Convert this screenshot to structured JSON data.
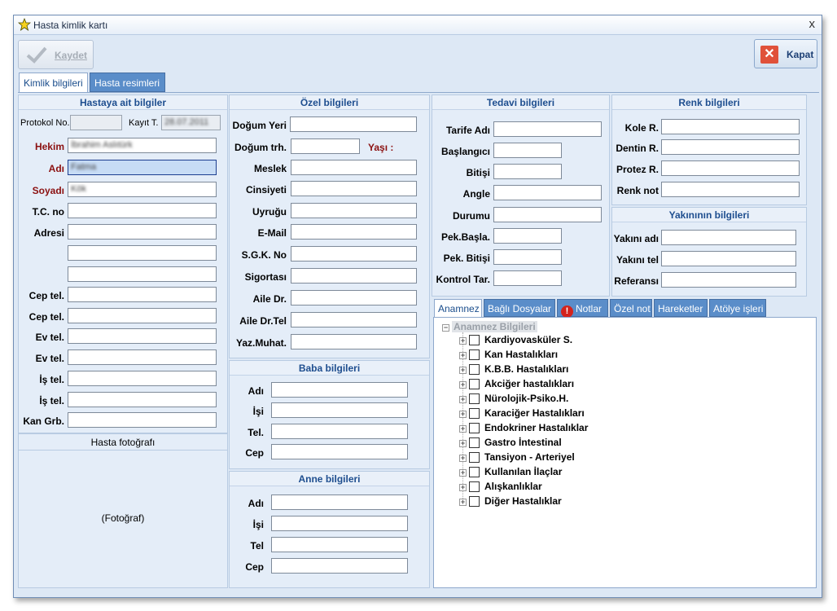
{
  "window": {
    "title": "Hasta kimlik kartı",
    "close_glyph": "x"
  },
  "toolbar": {
    "save_label": "Kaydet",
    "close_label": "Kapat"
  },
  "tabs": [
    "Kimlik bilgileri",
    "Hasta resimleri"
  ],
  "patient": {
    "header": "Hastaya ait bilgiler",
    "protocol_label": "Protokol No.",
    "protocol_value": "",
    "record_date_label": "Kayıt T.",
    "record_date_value": "28.07.2011",
    "doctor_label": "Hekim",
    "doctor_value": "İbrahim Aslıtürk",
    "name_label": "Adı",
    "name_value": "Fatma",
    "surname_label": "Soyadı",
    "surname_value": "Kök",
    "tc_label": "T.C. no",
    "address_label": "Adresi",
    "cep1_label": "Cep tel.",
    "cep2_label": "Cep tel.",
    "ev1_label": "Ev tel.",
    "ev2_label": "Ev tel.",
    "is1_label": "İş tel.",
    "is2_label": "İş tel.",
    "blood_label": "Kan Grb."
  },
  "photo": {
    "header": "Hasta fotoğrafı",
    "placeholder": "(Fotoğraf)"
  },
  "special": {
    "header": "Özel bilgileri",
    "birthplace_label": "Doğum Yeri",
    "birthdate_label": "Doğum trh.",
    "age_label": "Yaşı :",
    "job_label": "Meslek",
    "gender_label": "Cinsiyeti",
    "nationality_label": "Uyruğu",
    "email_label": "E-Mail",
    "sgk_label": "S.G.K. No",
    "insurance_label": "Sigortası",
    "family_dr_label": "Aile Dr.",
    "family_dr_tel_label": "Aile Dr.Tel",
    "correspondence_label": "Yaz.Muhat."
  },
  "father": {
    "header": "Baba bilgileri",
    "name_label": "Adı",
    "job_label": "İşi",
    "tel_label": "Tel.",
    "cep_label": "Cep"
  },
  "mother": {
    "header": "Anne bilgileri",
    "name_label": "Adı",
    "job_label": "İşi",
    "tel_label": "Tel",
    "cep_label": "Cep"
  },
  "treatment": {
    "header": "Tedavi bilgileri",
    "tariff_label": "Tarife Adı",
    "start_label": "Başlangıcı",
    "end_label": "Bitişi",
    "angle_label": "Angle",
    "status_label": "Durumu",
    "pek_start_label": "Pek.Başla.",
    "pek_end_label": "Pek. Bitişi",
    "control_label": "Kontrol Tar."
  },
  "color": {
    "header": "Renk bilgileri",
    "kole_label": "Kole R.",
    "dentin_label": "Dentin R.",
    "protez_label": "Protez R.",
    "note_label": "Renk not"
  },
  "relative": {
    "header": "Yakınının bilgileri",
    "name_label": "Yakını adı",
    "tel_label": "Yakını tel",
    "ref_label": "Referansı"
  },
  "subtabs": [
    "Anamnez",
    "Bağlı Dosyalar",
    "Notlar",
    "Özel not",
    "Hareketler",
    "Atölye işleri"
  ],
  "anamnez": {
    "root_label": "Anamnez Bilgileri",
    "items": [
      "Kardiyovasküler S.",
      "Kan Hastalıkları",
      "K.B.B. Hastalıkları",
      "Akciğer hastalıkları",
      "Nürolojik-Psiko.H.",
      "Karaciğer Hastalıkları",
      "Endokriner Hastalıklar",
      "Gastro İntestinal",
      "Tansiyon - Arteriyel",
      "Kullanılan İlaçlar",
      "Alışkanlıklar",
      "Diğer Hastalıklar"
    ]
  },
  "colors": {
    "accent_tab": "#5a8dc9",
    "header_text": "#1e4e8f",
    "required_label": "#8b1010",
    "close_icon": "#e0513a",
    "alert_icon": "#d4231c"
  }
}
